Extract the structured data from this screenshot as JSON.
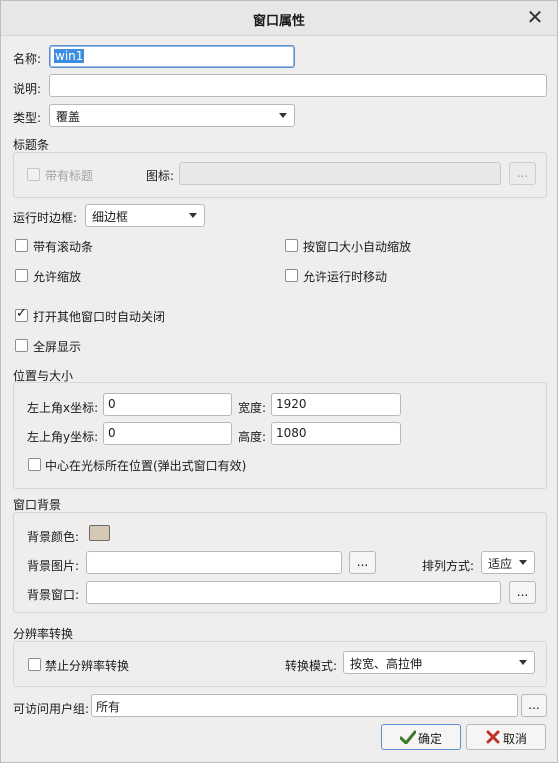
{
  "dialog": {
    "title": "窗口属性",
    "close_glyph": "✕"
  },
  "basic": {
    "name_label": "名称:",
    "name_value": "win1",
    "desc_label": "说明:",
    "desc_value": "",
    "type_label": "类型:",
    "type_value": "覆盖"
  },
  "titlebar_group": {
    "title": "标题条",
    "with_title_label": "带有标题",
    "with_title_checked": false,
    "icon_label": "图标:",
    "icon_value": "",
    "browse_label": "..."
  },
  "runtime": {
    "border_label": "运行时边框:",
    "border_value": "细边框",
    "scrollbar_label": "带有滚动条",
    "autoscale_label": "按窗口大小自动缩放",
    "allow_zoom_label": "允许缩放",
    "allow_move_label": "允许运行时移动",
    "auto_close_label": "打开其他窗口时自动关闭",
    "auto_close_checked": true,
    "fullscreen_label": "全屏显示"
  },
  "position": {
    "title": "位置与大小",
    "x_label": "左上角x坐标:",
    "x_value": "0",
    "y_label": "左上角y坐标:",
    "y_value": "0",
    "width_label": "宽度:",
    "width_value": "1920",
    "height_label": "高度:",
    "height_value": "1080",
    "center_label": "中心在光标所在位置(弹出式窗口有效)"
  },
  "background": {
    "title": "窗口背景",
    "color_label": "背景颜色:",
    "color_value": "#d6c8b5",
    "image_label": "背景图片:",
    "image_value": "",
    "browse_label": "...",
    "arrange_label": "排列方式:",
    "arrange_value": "适应",
    "window_label": "背景窗口:",
    "window_value": ""
  },
  "resolution": {
    "title": "分辨率转换",
    "disable_label": "禁止分辨率转换",
    "mode_label": "转换模式:",
    "mode_value": "按宽、高拉伸"
  },
  "access": {
    "label": "可访问用户组:",
    "value": "所有",
    "browse_label": "..."
  },
  "buttons": {
    "ok_label": "确定",
    "cancel_label": "取消"
  },
  "colors": {
    "focus_border": "#5b8fd0",
    "ok_icon": "#3a7a2a",
    "cancel_icon": "#c0302a"
  }
}
